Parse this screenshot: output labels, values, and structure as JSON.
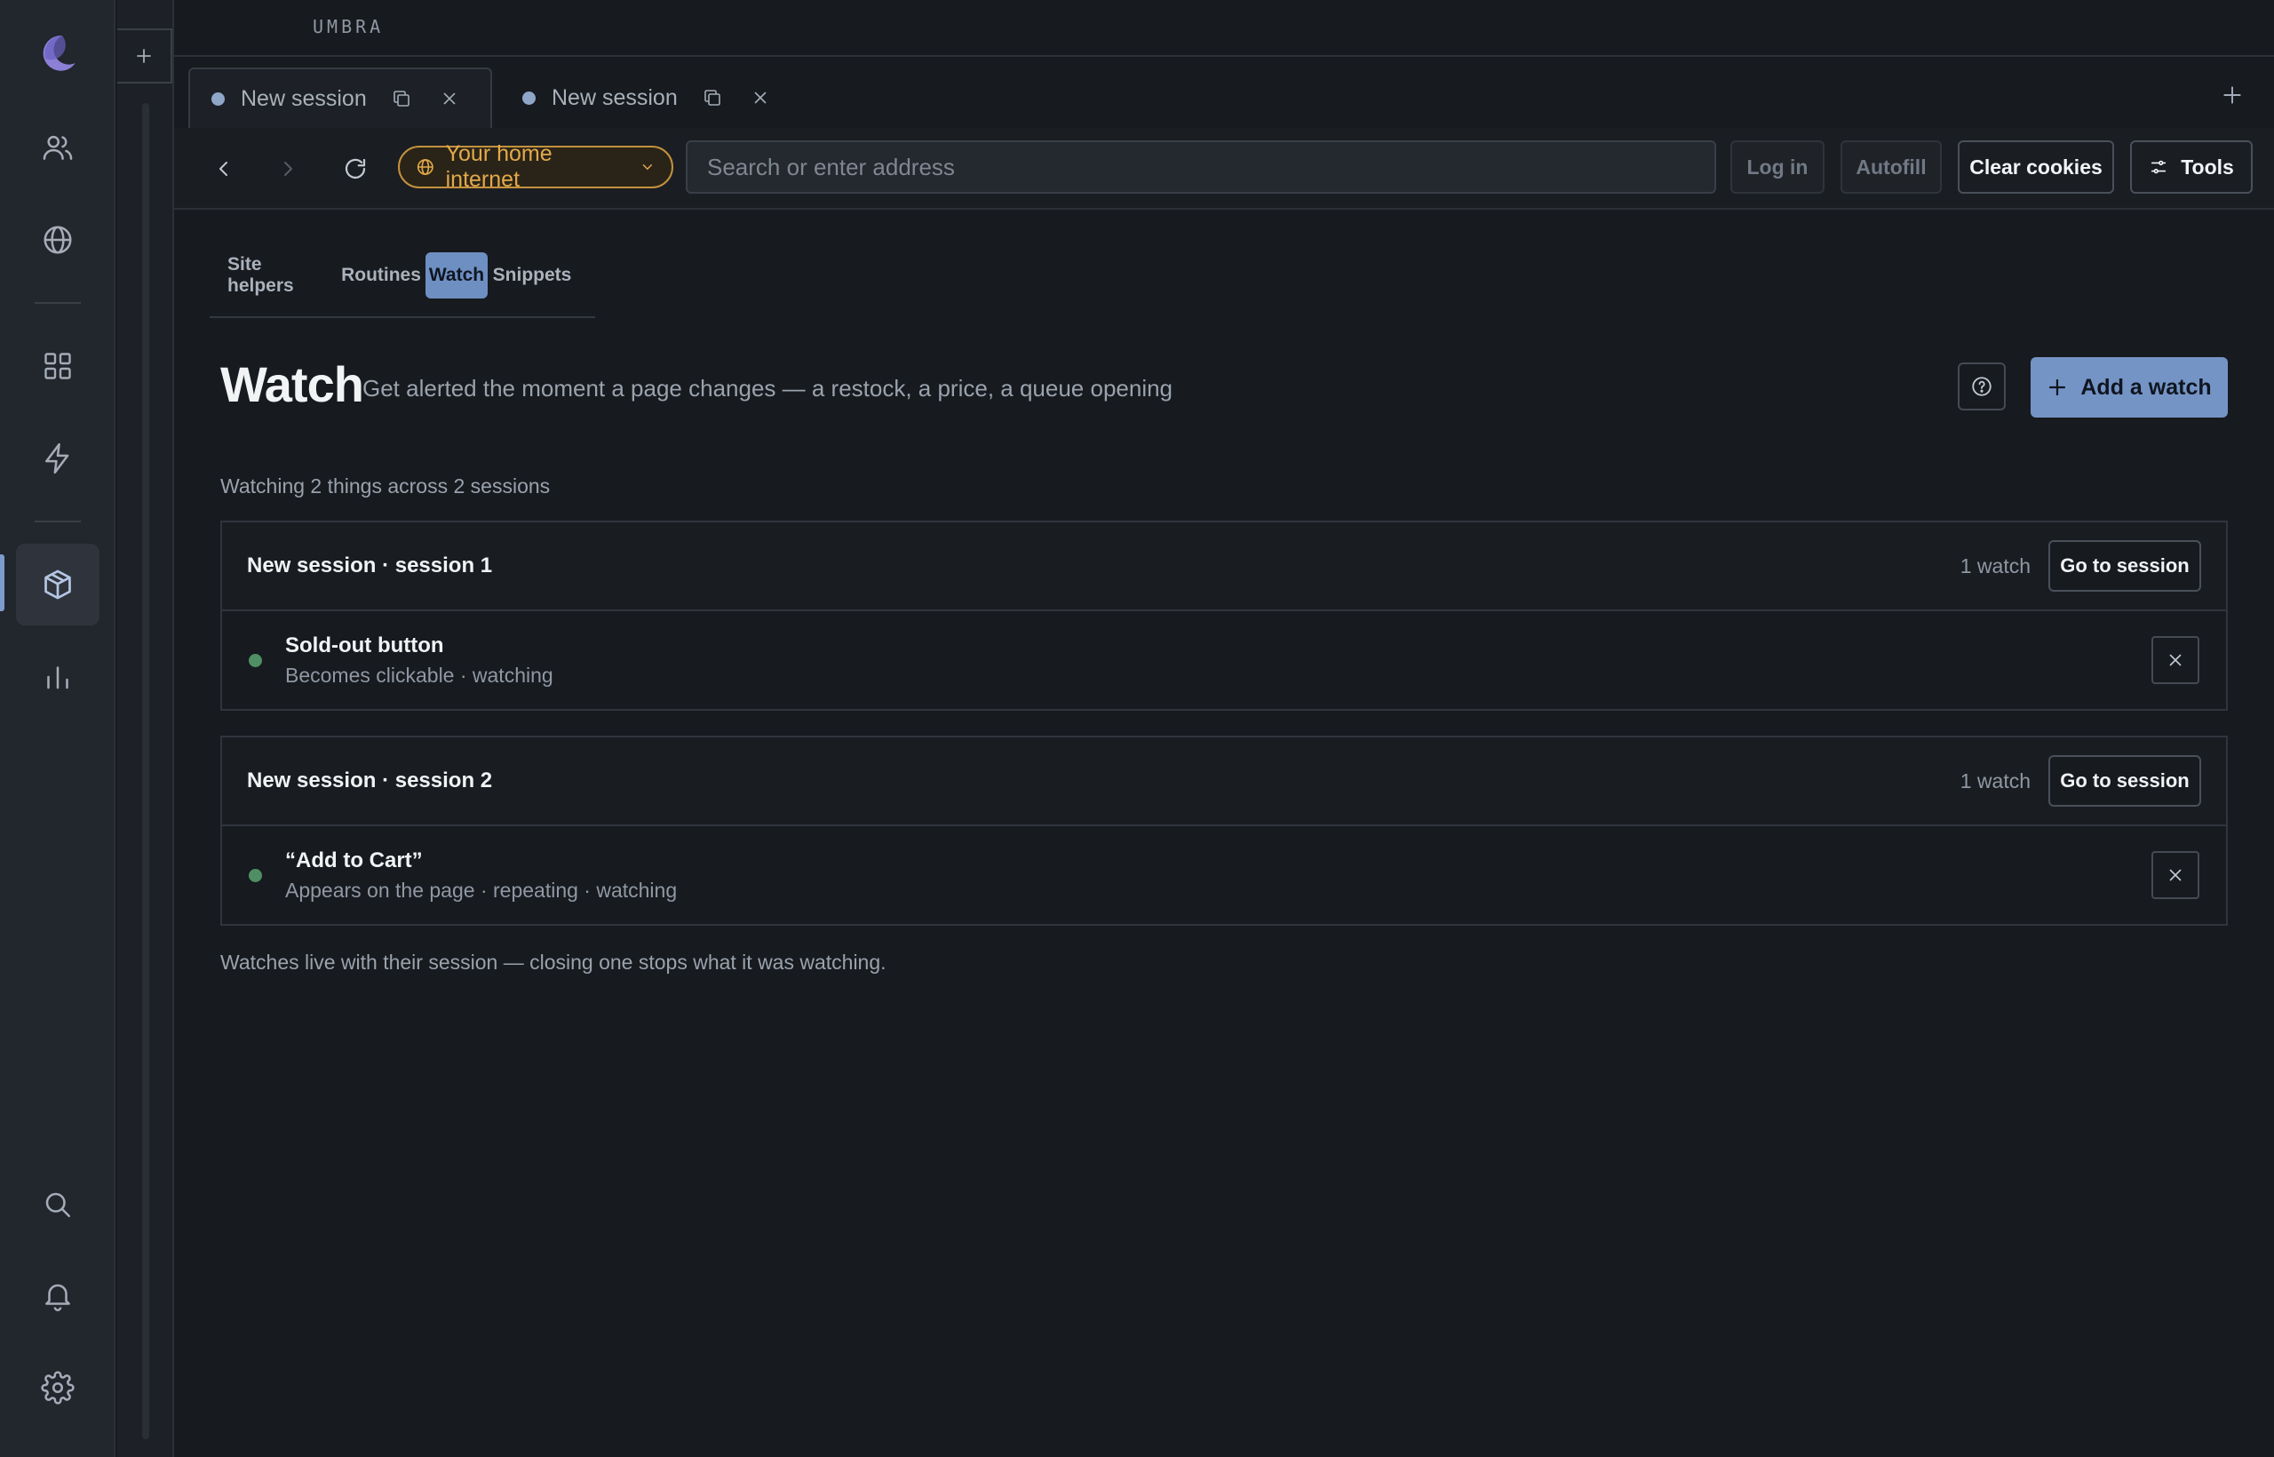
{
  "app": {
    "brand": "UMBRA"
  },
  "rail": {
    "items": [
      {
        "icon": "moon-logo-icon"
      },
      {
        "icon": "users-icon"
      },
      {
        "icon": "globe-icon"
      },
      {
        "icon": "grid-icon"
      },
      {
        "icon": "lightning-icon"
      },
      {
        "icon": "cube-icon",
        "active": true
      },
      {
        "icon": "bar-chart-icon"
      },
      {
        "icon": "search-icon"
      },
      {
        "icon": "bell-icon"
      },
      {
        "icon": "gear-icon"
      }
    ]
  },
  "tabs": [
    {
      "label": "New session",
      "active": true
    },
    {
      "label": "New session",
      "active": false
    }
  ],
  "toolbar": {
    "network_label": "Your home internet",
    "address_placeholder": "Search or enter address",
    "address_value": "",
    "login_label": "Log in",
    "autofill_label": "Autofill",
    "clear_cookies_label": "Clear cookies",
    "tools_label": "Tools"
  },
  "subtabs": [
    "Site helpers",
    "Routines",
    "Watch",
    "Snippets"
  ],
  "active_subtab": "Watch",
  "page": {
    "title": "Watch",
    "subtitle": "Get alerted the moment a page changes — a restock, a price, a queue opening",
    "add_button": "Add a watch",
    "summary": "Watching 2 things across 2 sessions",
    "footnote": "Watches live with their session — closing one stops what it was watching."
  },
  "groups": [
    {
      "title": "New session · session 1",
      "count": "1 watch",
      "goto_label": "Go to session",
      "watches": [
        {
          "name": "Sold-out button",
          "meta": "Becomes clickable · watching"
        }
      ]
    },
    {
      "title": "New session · session 2",
      "count": "1 watch",
      "goto_label": "Go to session",
      "watches": [
        {
          "name": "“Add to Cart”",
          "meta": "Appears on the page · repeating · watching"
        }
      ]
    }
  ],
  "colors": {
    "accent": "#7594c6",
    "network_warning": "#e3a94a",
    "status_ok": "#4f8f63",
    "background": "#171a1f"
  }
}
